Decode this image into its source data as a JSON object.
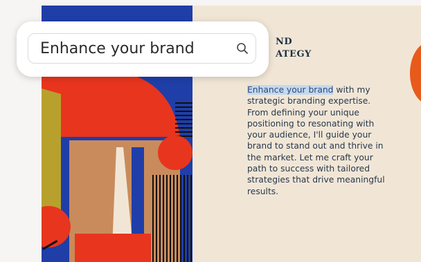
{
  "search": {
    "query": "Enhance your brand",
    "icon": "search-icon"
  },
  "poster": {
    "heading_lines": [
      "ND",
      "ATEGY"
    ],
    "body_highlight": "Enhance your brand",
    "body_rest": " with my strategic branding expertise. From defining your unique positioning to resonating with your audience, I'll guide your brand to stand out and thrive in the market. Let me craft your path to success with tailored strategies that drive meaningful results."
  },
  "colors": {
    "background": "#f6f5f3",
    "poster_bg": "#f1e6d6",
    "blue": "#1f3ea8",
    "red": "#e8351e",
    "tan": "#c98b5c",
    "olive": "#b7a12c",
    "text": "#27384d",
    "highlight": "#c4d8ee"
  }
}
